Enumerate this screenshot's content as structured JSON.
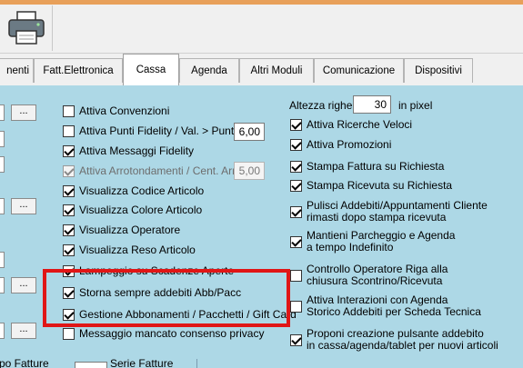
{
  "tabs": [
    {
      "label": "nenti"
    },
    {
      "label": "Fatt.Elettronica"
    },
    {
      "label": "Cassa"
    },
    {
      "label": "Agenda"
    },
    {
      "label": "Altri Moduli"
    },
    {
      "label": "Comunicazione"
    },
    {
      "label": "Dispositivi"
    }
  ],
  "active_tab": "Cassa",
  "left_buttons": [
    {
      "label": "..."
    },
    {
      "label": "..."
    },
    {
      "label": "..."
    },
    {
      "label": "..."
    }
  ],
  "middle_column": [
    {
      "label": "Attiva Convenzioni",
      "checked": false
    },
    {
      "label": "Attiva Punti Fidelity / Val. > Punti",
      "checked": false
    },
    {
      "label": "Attiva Messaggi Fidelity",
      "checked": true
    },
    {
      "label": "Attiva Arrotondamenti / Cent. Arr.",
      "checked": true,
      "disabled": true
    },
    {
      "label": "Visualizza Codice Articolo",
      "checked": true
    },
    {
      "label": "Visualizza Colore Articolo",
      "checked": true
    },
    {
      "label": "Visualizza Operatore",
      "checked": true
    },
    {
      "label": "Visualizza Reso Articolo",
      "checked": true
    },
    {
      "label": "Lampeggio su Scadenze Aperte",
      "checked": true
    },
    {
      "label": "Storna sempre addebiti Abb/Pacc",
      "checked": true
    },
    {
      "label": "Gestione Abbonamenti / Pacchetti / Gift Card",
      "checked": true
    },
    {
      "label": "Messaggio mancato consenso privacy",
      "checked": false
    }
  ],
  "fidelity_value": "6,00",
  "rounding_value": "5,00",
  "row_height": {
    "label": "Altezza righe",
    "value": "30",
    "unit": "in pixel"
  },
  "right_column": [
    {
      "label": "Attiva Ricerche Veloci",
      "checked": true
    },
    {
      "label": "Attiva Promozioni",
      "checked": true
    },
    {
      "label": "Stampa Fattura su Richiesta",
      "checked": true
    },
    {
      "label": "Stampa Ricevuta su Richiesta",
      "checked": true
    },
    {
      "label": "Pulisci Addebiti/Appuntamenti Cliente rimasti dopo stampa ricevuta",
      "line1": "Pulisci Addebiti/Appuntamenti Cliente",
      "line2": "rimasti dopo stampa ricevuta",
      "checked": true
    },
    {
      "label": "Mantieni Parcheggio e Agenda a tempo Indefinito",
      "line1": "Mantieni Parcheggio e Agenda",
      "line2": "a tempo Indefinito",
      "checked": true
    },
    {
      "label": "Controllo Operatore Riga alla chiusura Scontrino/Ricevuta",
      "line1": "Controllo Operatore Riga alla",
      "line2": "chiusura Scontrino/Ricevuta",
      "checked": false
    },
    {
      "label": "Attiva Interazioni con Agenda Storico Addebiti per Scheda Tecnica",
      "line1": "Attiva Interazioni con Agenda",
      "line2": "Storico Addebiti per Scheda Tecnica",
      "checked": false
    },
    {
      "label": "Proponi creazione pulsante addebito in cassa/agenda/tablet per nuovi articoli",
      "line1": "Proponi creazione pulsante addebito",
      "line2": "in cassa/agenda/tablet per nuovi articoli",
      "checked": true
    }
  ],
  "bottom": {
    "left_label": "po Fatture",
    "right_label": "Serie Fatture"
  },
  "colors": {
    "panel": "#add8e6",
    "highlight": "#e01616",
    "accent": "#e8a05a"
  },
  "icons": [
    "printer-icon",
    "check-icon"
  ]
}
